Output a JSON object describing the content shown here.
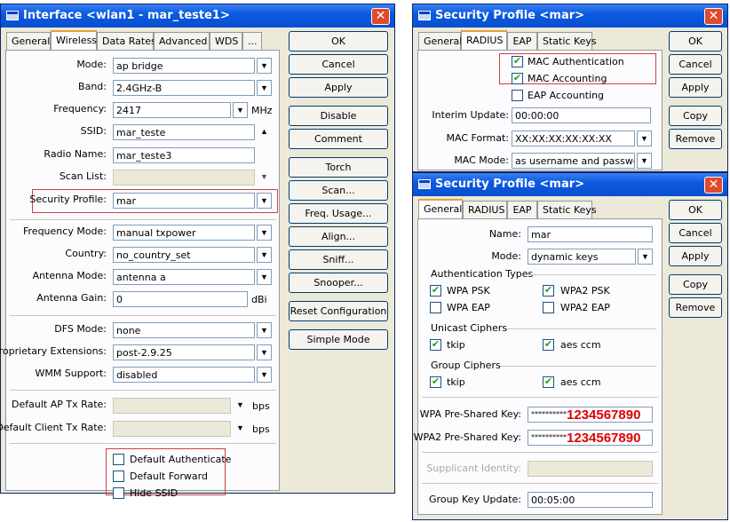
{
  "win1": {
    "title": "Interface <wlan1 - mar_teste1>",
    "tabs": [
      "General",
      "Wireless",
      "Data Rates",
      "Advanced",
      "WDS",
      "..."
    ],
    "fields": {
      "mode": {
        "label": "Mode:",
        "value": "ap bridge"
      },
      "band": {
        "label": "Band:",
        "value": "2.4GHz-B"
      },
      "frequency": {
        "label": "Frequency:",
        "value": "2417",
        "unit": "MHz"
      },
      "ssid": {
        "label": "SSID:",
        "value": "mar_teste"
      },
      "radio_name": {
        "label": "Radio Name:",
        "value": "mar_teste3"
      },
      "scan_list": {
        "label": "Scan List:",
        "value": ""
      },
      "security_profile": {
        "label": "Security Profile:",
        "value": "mar"
      },
      "frequency_mode": {
        "label": "Frequency Mode:",
        "value": "manual txpower"
      },
      "country": {
        "label": "Country:",
        "value": "no_country_set"
      },
      "antenna_mode": {
        "label": "Antenna Mode:",
        "value": "antenna a"
      },
      "antenna_gain": {
        "label": "Antenna Gain:",
        "value": "0",
        "unit": "dBi"
      },
      "dfs_mode": {
        "label": "DFS Mode:",
        "value": "none"
      },
      "proprietary_extensions": {
        "label": "Proprietary Extensions:",
        "value": "post-2.9.25"
      },
      "wmm_support": {
        "label": "WMM Support:",
        "value": "disabled"
      },
      "default_ap_tx_rate": {
        "label": "Default AP Tx Rate:",
        "value": "",
        "unit": "bps"
      },
      "default_client_tx_rate": {
        "label": "Default Client Tx Rate:",
        "value": "",
        "unit": "bps"
      }
    },
    "checkboxes": [
      {
        "label": "Default Authenticate",
        "checked": false
      },
      {
        "label": "Default Forward",
        "checked": false
      },
      {
        "label": "Hide SSID",
        "checked": false
      }
    ],
    "buttons": [
      "OK",
      "Cancel",
      "Apply",
      "Disable",
      "Comment",
      "Torch",
      "Scan...",
      "Freq. Usage...",
      "Align...",
      "Sniff...",
      "Snooper...",
      "Reset Configuration",
      "Simple Mode"
    ]
  },
  "win2": {
    "title": "Security Profile <mar>",
    "tabs": [
      "General",
      "RADIUS",
      "EAP",
      "Static Keys"
    ],
    "checkboxes": [
      {
        "label": "MAC Authentication",
        "checked": true
      },
      {
        "label": "MAC Accounting",
        "checked": true
      },
      {
        "label": "EAP Accounting",
        "checked": false
      }
    ],
    "fields": {
      "interim_update": {
        "label": "Interim Update:",
        "value": "00:00:00"
      },
      "mac_format": {
        "label": "MAC Format:",
        "value": "XX:XX:XX:XX:XX:XX"
      },
      "mac_mode": {
        "label": "MAC Mode:",
        "value": "as username and password"
      }
    },
    "buttons": [
      "OK",
      "Cancel",
      "Apply",
      "Copy",
      "Remove"
    ]
  },
  "win3": {
    "title": "Security Profile <mar>",
    "tabs": [
      "General",
      "RADIUS",
      "EAP",
      "Static Keys"
    ],
    "fields": {
      "name": {
        "label": "Name:",
        "value": "mar"
      },
      "mode": {
        "label": "Mode:",
        "value": "dynamic keys"
      },
      "wpa_psk": {
        "label": "WPA Pre-Shared Key:",
        "value": "**********"
      },
      "wpa2_psk": {
        "label": "WPA2 Pre-Shared Key:",
        "value": "**********"
      },
      "supplicant_identity": {
        "label": "Supplicant Identity:",
        "value": ""
      },
      "group_key_update": {
        "label": "Group Key Update:",
        "value": "00:05:00"
      }
    },
    "groups": {
      "auth": "Authentication Types",
      "unicast": "Unicast Ciphers",
      "group": "Group Ciphers"
    },
    "auth_types": [
      {
        "label": "WPA PSK",
        "checked": true
      },
      {
        "label": "WPA2 PSK",
        "checked": true
      },
      {
        "label": "WPA EAP",
        "checked": false
      },
      {
        "label": "WPA2 EAP",
        "checked": false
      }
    ],
    "unicast": [
      {
        "label": "tkip",
        "checked": true
      },
      {
        "label": "aes ccm",
        "checked": true
      }
    ],
    "group_ciphers": [
      {
        "label": "tkip",
        "checked": true
      },
      {
        "label": "aes ccm",
        "checked": true
      }
    ],
    "annotations": {
      "wpa_key": "1234567890",
      "wpa2_key": "1234567890"
    },
    "buttons": [
      "OK",
      "Cancel",
      "Apply",
      "Copy",
      "Remove"
    ]
  },
  "icons": {
    "close": "close-icon",
    "dropdown": "dropdown-arrow-icon",
    "up": "up-arrow-icon",
    "check": "checkmark-icon"
  },
  "colors": {
    "titlebar": "#0b5ae0",
    "highlight": "#d04040",
    "annotation": "#e00000"
  }
}
